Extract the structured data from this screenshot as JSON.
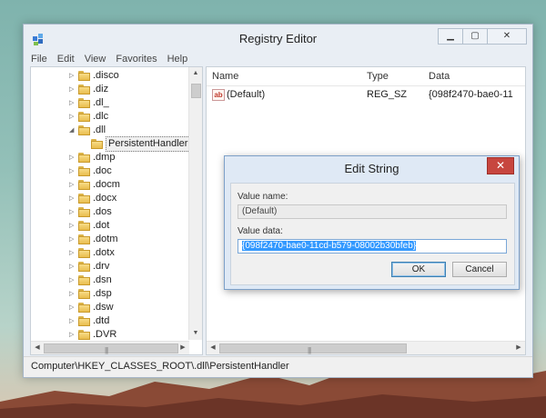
{
  "window": {
    "title": "Registry Editor"
  },
  "menu": [
    "File",
    "Edit",
    "View",
    "Favorites",
    "Help"
  ],
  "tree": {
    "items": [
      {
        "label": ".disco",
        "expander": "▷"
      },
      {
        "label": ".diz",
        "expander": "▷"
      },
      {
        "label": ".dl_",
        "expander": "▷"
      },
      {
        "label": ".dlc",
        "expander": "▷"
      },
      {
        "label": ".dll",
        "expander": "◢"
      },
      {
        "label": "PersistentHandler",
        "expander": "",
        "selected": true,
        "child": true
      },
      {
        "label": ".dmp",
        "expander": "▷"
      },
      {
        "label": ".doc",
        "expander": "▷"
      },
      {
        "label": ".docm",
        "expander": "▷"
      },
      {
        "label": ".docx",
        "expander": "▷"
      },
      {
        "label": ".dos",
        "expander": "▷"
      },
      {
        "label": ".dot",
        "expander": "▷"
      },
      {
        "label": ".dotm",
        "expander": "▷"
      },
      {
        "label": ".dotx",
        "expander": "▷"
      },
      {
        "label": ".drv",
        "expander": "▷"
      },
      {
        "label": ".dsn",
        "expander": "▷"
      },
      {
        "label": ".dsp",
        "expander": "▷"
      },
      {
        "label": ".dsw",
        "expander": "▷"
      },
      {
        "label": ".dtd",
        "expander": "▷"
      },
      {
        "label": ".DVR",
        "expander": "▷"
      }
    ]
  },
  "list": {
    "columns": [
      "Name",
      "Type",
      "Data"
    ],
    "rows": [
      {
        "icon": "ab",
        "name": "(Default)",
        "type": "REG_SZ",
        "data": "{098f2470-bae0-11"
      }
    ]
  },
  "statusbar": "Computer\\HKEY_CLASSES_ROOT\\.dll\\PersistentHandler",
  "dialog": {
    "title": "Edit String",
    "close_glyph": "✕",
    "value_name_label": "Value name:",
    "value_name": "(Default)",
    "value_data_label": "Value data:",
    "value_data": "{098f2470-bae0-11cd-b579-08002b30bfeb}",
    "ok": "OK",
    "cancel": "Cancel"
  },
  "icons": {
    "app": "registry-editor-icon",
    "folder": "folder-icon",
    "string_value": "string-value-icon"
  },
  "colors": {
    "close_button": "#c7463f",
    "selection": "#3399ff",
    "folder": "#e9bd4e"
  }
}
